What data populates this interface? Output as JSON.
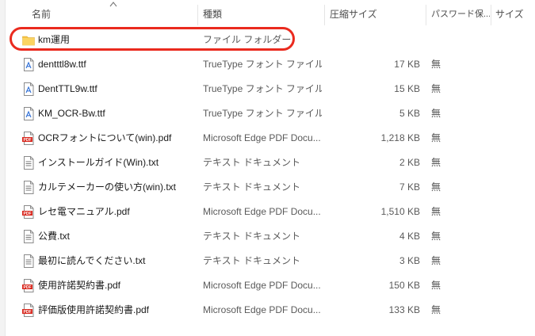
{
  "columns": {
    "name": "名前",
    "type": "種類",
    "compressed_size": "圧縮サイズ",
    "password": "パスワード保...",
    "size": "サイズ"
  },
  "files": [
    {
      "name": "km運用",
      "type": "ファイル フォルダー",
      "size": "",
      "protected": "",
      "icon": "folder-icon"
    },
    {
      "name": "dentttl8w.ttf",
      "type": "TrueType フォント ファイル",
      "size": "17 KB",
      "protected": "無",
      "icon": "font-file-icon"
    },
    {
      "name": "DentTTL9w.ttf",
      "type": "TrueType フォント ファイル",
      "size": "15 KB",
      "protected": "無",
      "icon": "font-file-icon"
    },
    {
      "name": "KM_OCR-Bw.ttf",
      "type": "TrueType フォント ファイル",
      "size": "5 KB",
      "protected": "無",
      "icon": "font-file-icon"
    },
    {
      "name": "OCRフォントについて(win).pdf",
      "type": "Microsoft Edge PDF Docu...",
      "size": "1,218 KB",
      "protected": "無",
      "icon": "pdf-file-icon"
    },
    {
      "name": "インストールガイド(Win).txt",
      "type": "テキスト ドキュメント",
      "size": "2 KB",
      "protected": "無",
      "icon": "text-file-icon"
    },
    {
      "name": "カルテメーカーの使い方(win).txt",
      "type": "テキスト ドキュメント",
      "size": "7 KB",
      "protected": "無",
      "icon": "text-file-icon"
    },
    {
      "name": "レセ電マニュアル.pdf",
      "type": "Microsoft Edge PDF Docu...",
      "size": "1,510 KB",
      "protected": "無",
      "icon": "pdf-file-icon"
    },
    {
      "name": "公費.txt",
      "type": "テキスト ドキュメント",
      "size": "4 KB",
      "protected": "無",
      "icon": "text-file-icon"
    },
    {
      "name": "最初に読んでください.txt",
      "type": "テキスト ドキュメント",
      "size": "3 KB",
      "protected": "無",
      "icon": "text-file-icon"
    },
    {
      "name": "使用許諾契約書.pdf",
      "type": "Microsoft Edge PDF Docu...",
      "size": "150 KB",
      "protected": "無",
      "icon": "pdf-file-icon"
    },
    {
      "name": "評価版使用許諾契約書.pdf",
      "type": "Microsoft Edge PDF Docu...",
      "size": "133 KB",
      "protected": "無",
      "icon": "pdf-file-icon"
    }
  ],
  "pdf_badge": "PDF",
  "colors": {
    "highlight": "#ea2a1e",
    "folder": "#f6c445",
    "pdf": "#d9261c"
  }
}
